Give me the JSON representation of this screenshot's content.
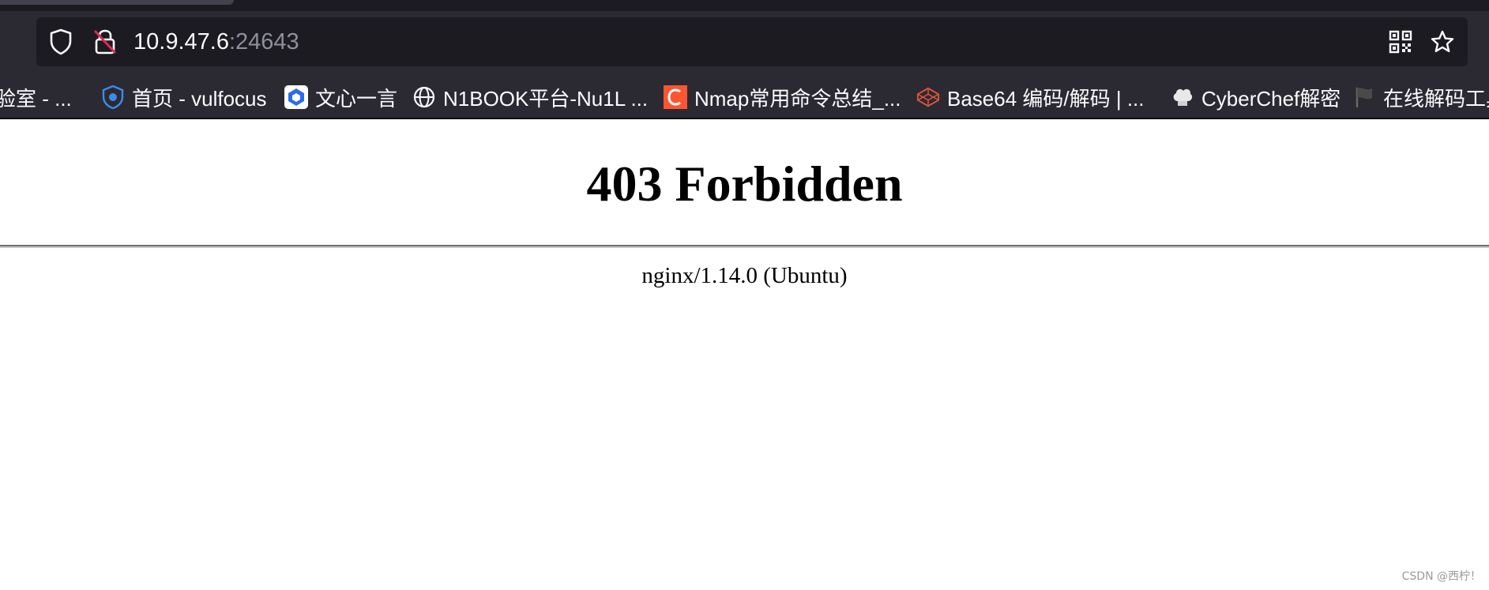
{
  "browser": {
    "url_host": "10.9.47.6",
    "url_port": ":24643",
    "icons": [
      "shield-icon",
      "insecure-lock-icon",
      "qr-code-icon",
      "bookmark-star-icon"
    ]
  },
  "bookmarks": [
    {
      "label": "验室 - ...",
      "icon": "none"
    },
    {
      "label": "首页 - vulfocus",
      "icon": "vulfocus-icon"
    },
    {
      "label": "文心一言",
      "icon": "wenxin-icon"
    },
    {
      "label": "N1BOOK平台-Nu1L ...",
      "icon": "globe-icon"
    },
    {
      "label": "Nmap常用命令总结_...",
      "icon": "csdn-icon"
    },
    {
      "label": "Base64 编码/解码 | ...",
      "icon": "codepen-icon"
    },
    {
      "label": "CyberChef解密",
      "icon": "chef-icon"
    },
    {
      "label": "在线解码工具",
      "icon": "flag-icon"
    }
  ],
  "page": {
    "heading": "403 Forbidden",
    "server": "nginx/1.14.0 (Ubuntu)"
  },
  "watermark": "CSDN @西柠！",
  "colors": {
    "toolbar_bg": "#2b2a33",
    "urlbar_bg": "#1c1b22",
    "text_light": "#fbfbfe",
    "port_gray": "#8f8f9d",
    "csdn_red": "#fc5531",
    "vulfocus_blue": "#3b8beb"
  }
}
